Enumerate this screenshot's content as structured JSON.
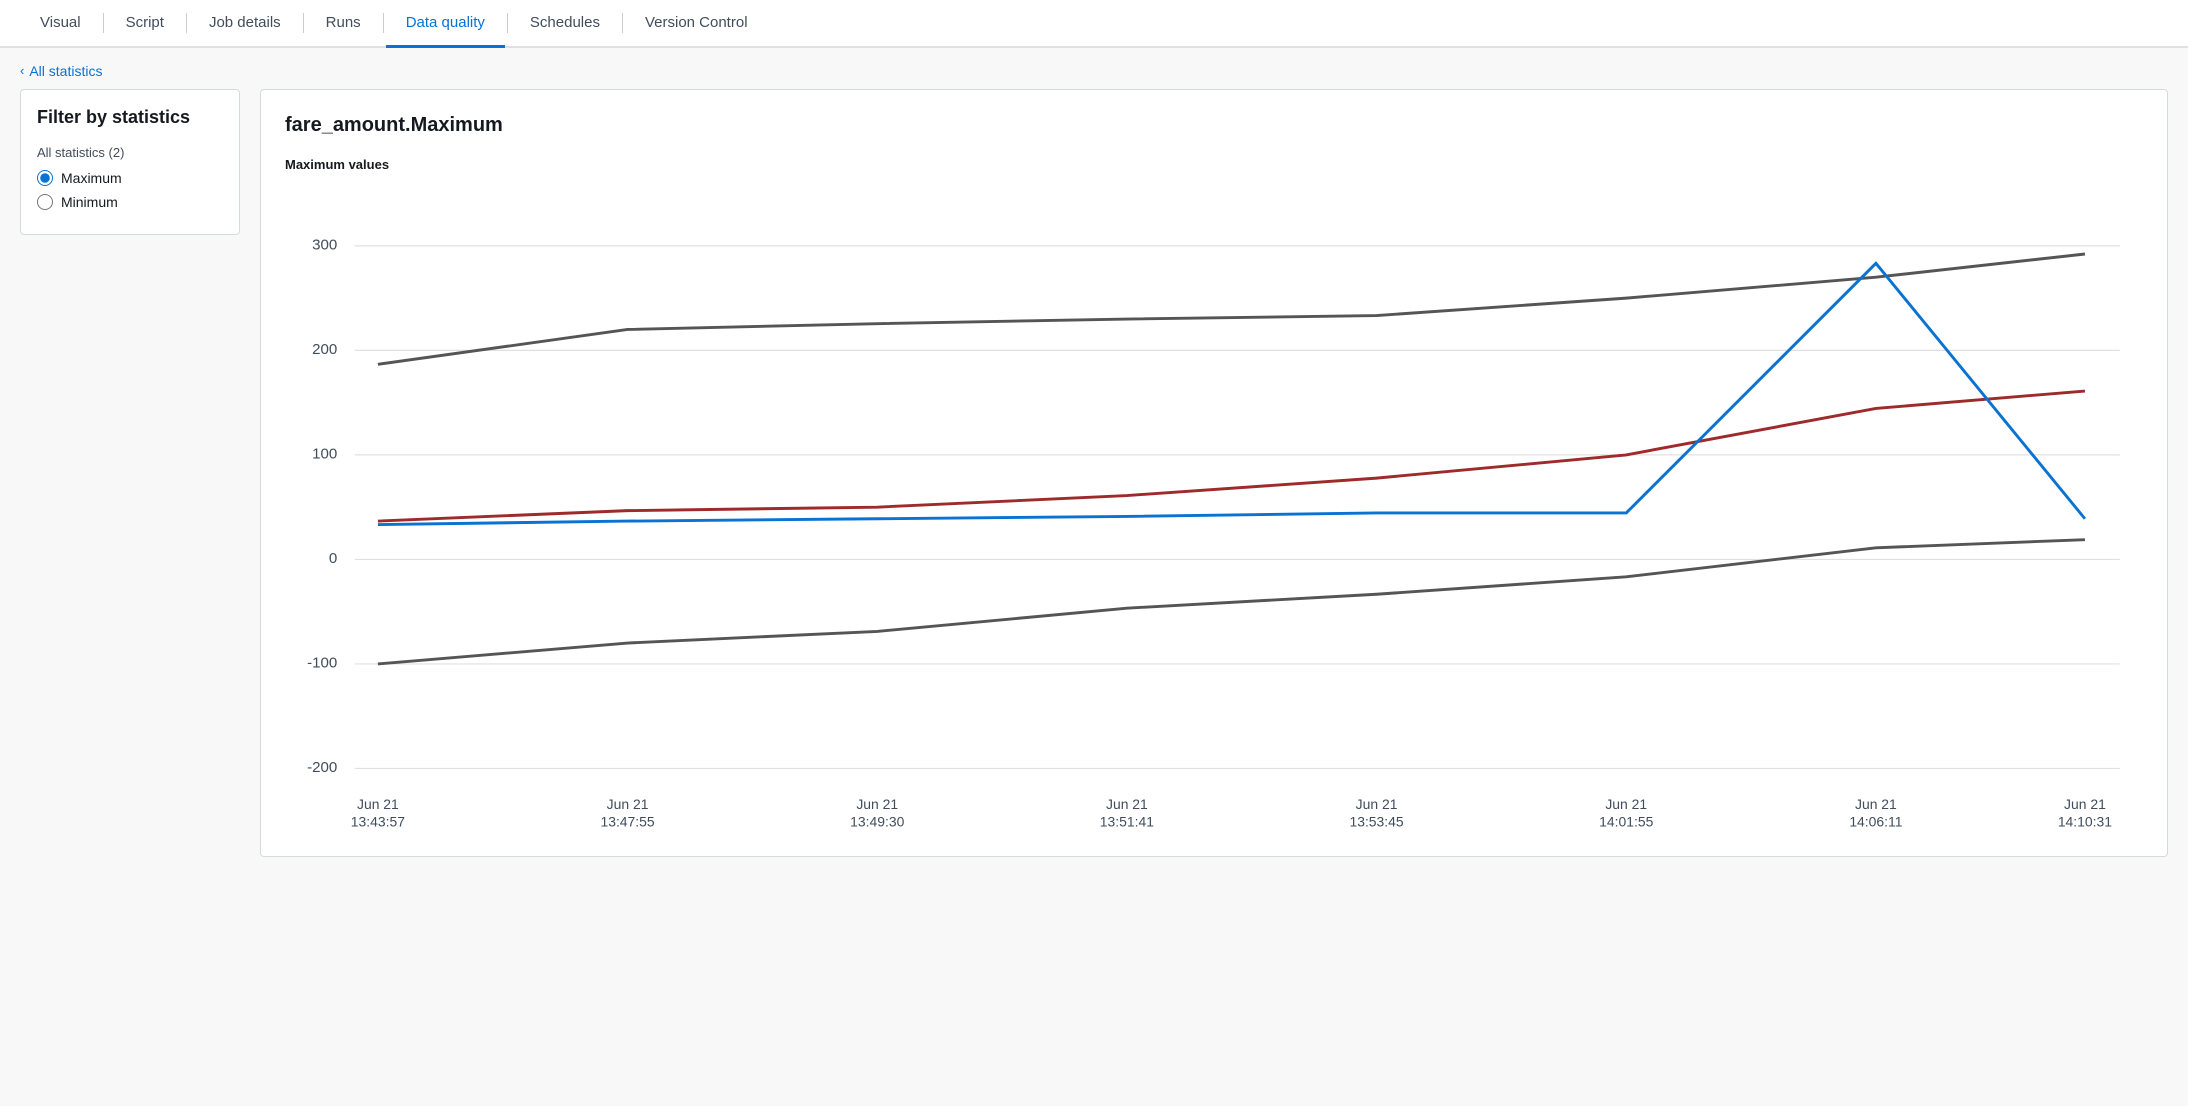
{
  "tabs": [
    {
      "id": "visual",
      "label": "Visual",
      "active": false
    },
    {
      "id": "script",
      "label": "Script",
      "active": false
    },
    {
      "id": "job-details",
      "label": "Job details",
      "active": false
    },
    {
      "id": "runs",
      "label": "Runs",
      "active": false
    },
    {
      "id": "data-quality",
      "label": "Data quality",
      "active": true
    },
    {
      "id": "schedules",
      "label": "Schedules",
      "active": false
    },
    {
      "id": "version-control",
      "label": "Version Control",
      "active": false
    }
  ],
  "breadcrumb": {
    "label": "All statistics",
    "icon": "chevron-left"
  },
  "filter": {
    "title": "Filter by statistics",
    "section_label": "All statistics (2)",
    "options": [
      {
        "id": "maximum",
        "label": "Maximum",
        "checked": true
      },
      {
        "id": "minimum",
        "label": "Minimum",
        "checked": false
      }
    ]
  },
  "chart": {
    "title": "fare_amount.Maximum",
    "subtitle": "Maximum values",
    "x_labels": [
      "Jun 21\n13:43:57",
      "Jun 21\n13:47:55",
      "Jun 21\n13:49:30",
      "Jun 21\n13:51:41",
      "Jun 21\n13:53:45",
      "Jun 21\n14:01:55",
      "Jun 21\n14:06:11",
      "Jun 21\n14:10:31"
    ],
    "y_labels": [
      "300",
      "200",
      "100",
      "0",
      "-100",
      "-200"
    ]
  }
}
